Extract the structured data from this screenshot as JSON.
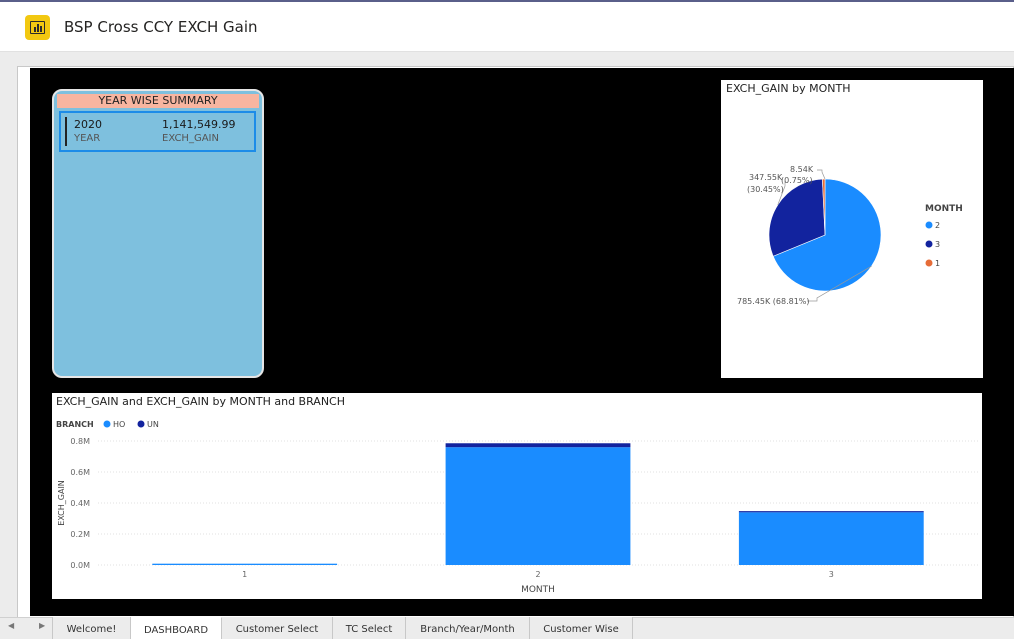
{
  "window": {
    "title": "BSP Cross CCY EXCH Gain"
  },
  "summary_card": {
    "title": "YEAR WISE SUMMARY",
    "year_value": "2020",
    "year_label": "YEAR",
    "gain_value": "1,141,549.99",
    "gain_label": "EXCH_GAIN"
  },
  "chart_data": [
    {
      "type": "pie",
      "title": "EXCH_GAIN by MONTH",
      "legend_title": "MONTH",
      "legend_position": "right",
      "slices": [
        {
          "label": "2",
          "value": 785450,
          "display": "785.45K (68.81%)",
          "color": "#1a8cff"
        },
        {
          "label": "3",
          "value": 347550,
          "display": "347.55K (30.45%)",
          "color": "#12239e"
        },
        {
          "label": "1",
          "value": 8540,
          "display": "8.54K (0.75%)",
          "color": "#e66c37"
        }
      ]
    },
    {
      "type": "bar",
      "stacked": true,
      "title": "EXCH_GAIN and EXCH_GAIN by MONTH and BRANCH",
      "legend_title": "BRANCH",
      "legend_position": "top-left",
      "xlabel": "MONTH",
      "ylabel": "EXCH_GAIN",
      "categories": [
        "1",
        "2",
        "3"
      ],
      "yticks": [
        "0.0M",
        "0.2M",
        "0.4M",
        "0.6M",
        "0.8M"
      ],
      "ylim": [
        0,
        800000
      ],
      "grid": true,
      "series": [
        {
          "name": "HO",
          "color": "#1a8cff",
          "values": [
            8540,
            760000,
            340000
          ]
        },
        {
          "name": "UN",
          "color": "#12239e",
          "values": [
            0,
            25450,
            7550
          ]
        }
      ]
    }
  ],
  "tabs": [
    {
      "label": "Welcome!",
      "active": false
    },
    {
      "label": "DASHBOARD",
      "active": true
    },
    {
      "label": "Customer Select",
      "active": false
    },
    {
      "label": "TC Select",
      "active": false
    },
    {
      "label": "Branch/Year/Month",
      "active": false
    },
    {
      "label": "Customer Wise",
      "active": false
    }
  ],
  "nav": {
    "prev_icon": "chevron-left-icon",
    "next_icon": "chevron-right-icon",
    "prev_glyph": "◀",
    "next_glyph": "▶"
  }
}
